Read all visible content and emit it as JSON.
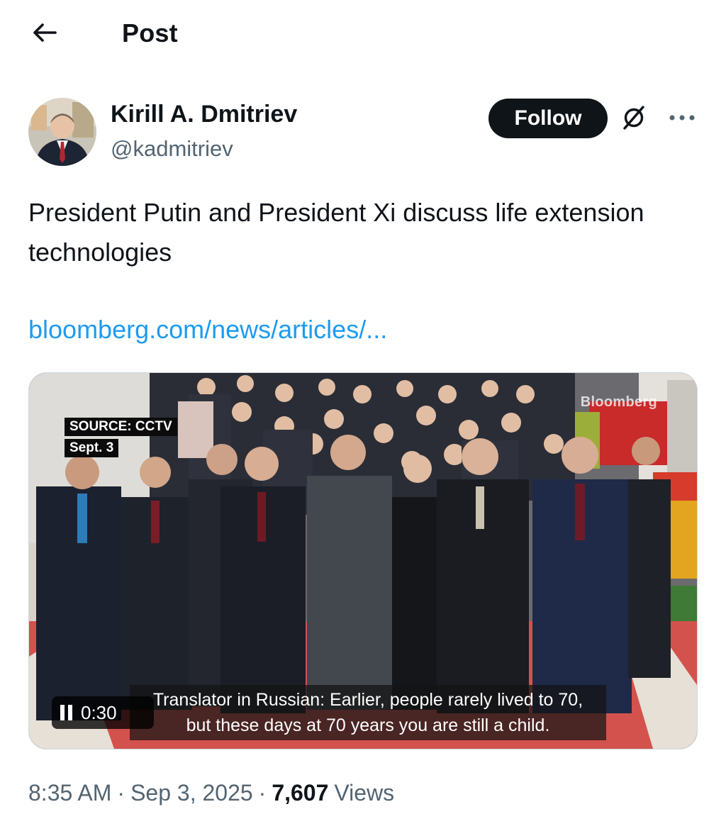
{
  "header": {
    "back_icon": "arrow-left-icon",
    "title": "Post"
  },
  "author": {
    "display_name": "Kirill A. Dmitriev",
    "handle": "@kadmitriev",
    "follow_label": "Follow",
    "grok_icon": "grok-icon",
    "more_icon": "more-horizontal-icon"
  },
  "post": {
    "text": "President Putin and President Xi discuss life extension technologies",
    "link": "bloomberg.com/news/articles/..."
  },
  "media": {
    "source_line1": "SOURCE: CCTV",
    "source_line2": "Sept. 3",
    "watermark": "Bloomberg",
    "subtitle_line1": "Translator in Russian: Earlier, people rarely lived to 70,",
    "subtitle_line2": "but these days at 70 years you are still a child.",
    "duration": "0:30",
    "pause_icon": "pause-icon"
  },
  "meta": {
    "time": "8:35 AM",
    "sep1": "·",
    "date": "Sep 3, 2025",
    "sep2": "·",
    "views_count": "7,607",
    "views_label": "Views"
  },
  "colors": {
    "accent_link": "#1d9bf0",
    "text_primary": "#0f1419",
    "text_secondary": "#536471",
    "follow_bg": "#0f1419"
  }
}
